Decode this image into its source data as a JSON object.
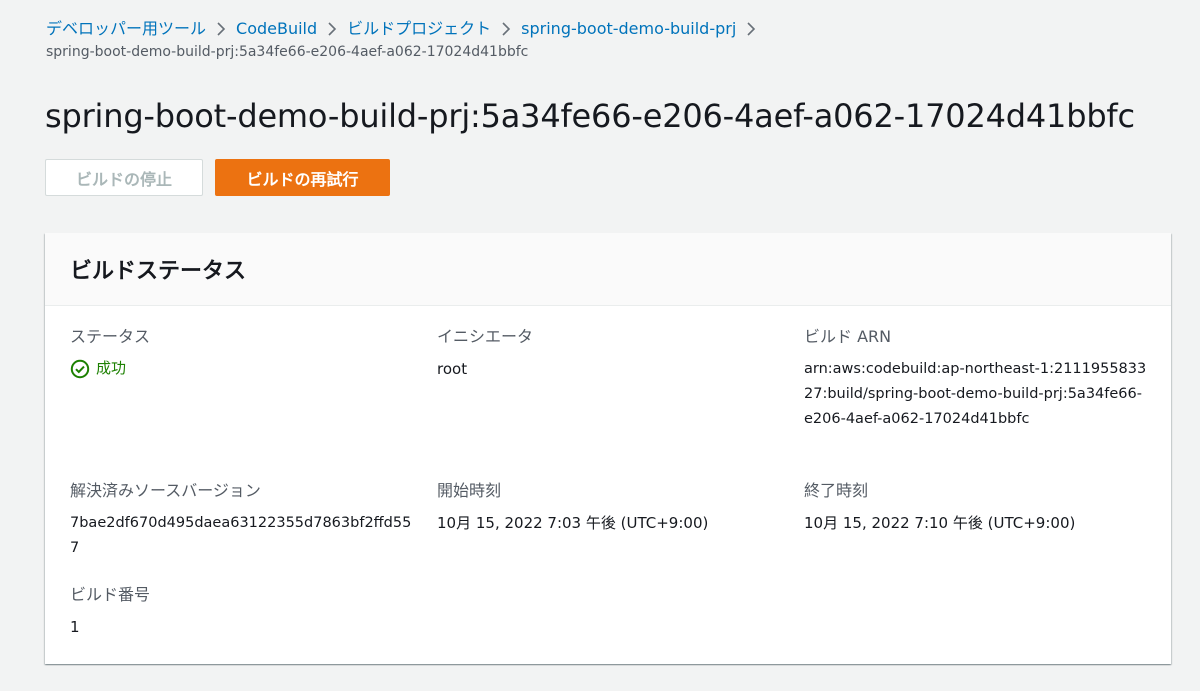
{
  "breadcrumb": {
    "items": [
      {
        "label": "デベロッパー用ツール"
      },
      {
        "label": "CodeBuild"
      },
      {
        "label": "ビルドプロジェクト"
      },
      {
        "label": "spring-boot-demo-build-prj"
      }
    ],
    "current": "spring-boot-demo-build-prj:5a34fe66-e206-4aef-a062-17024d41bbfc"
  },
  "page": {
    "title": "spring-boot-demo-build-prj:5a34fe66-e206-4aef-a062-17024d41bbfc"
  },
  "actions": {
    "stop_label": "ビルドの停止",
    "retry_label": "ビルドの再試行"
  },
  "panel": {
    "title": "ビルドステータス",
    "status": {
      "label": "ステータス",
      "value": "成功",
      "icon": "check-circle-icon",
      "color": "#1d8102"
    },
    "initiator": {
      "label": "イニシエータ",
      "value": "root"
    },
    "arn": {
      "label": "ビルド ARN",
      "value": "arn:aws:codebuild:ap-northeast-1:211195583327:build/spring-boot-demo-build-prj:5a34fe66-e206-4aef-a062-17024d41bbfc"
    },
    "source_version": {
      "label": "解決済みソースバージョン",
      "value": "7bae2df670d495daea63122355d7863bf2ffd557"
    },
    "start_time": {
      "label": "開始時刻",
      "value": "10月 15, 2022 7:03 午後 (UTC+9:00)"
    },
    "end_time": {
      "label": "終了時刻",
      "value": "10月 15, 2022 7:10 午後 (UTC+9:00)"
    },
    "build_number": {
      "label": "ビルド番号",
      "value": "1"
    }
  },
  "colors": {
    "link": "#0073bb",
    "primary_button": "#ec7211",
    "success": "#1d8102"
  }
}
